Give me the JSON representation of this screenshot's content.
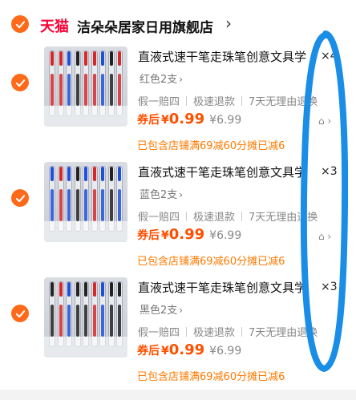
{
  "shop": {
    "platform": "天猫",
    "name": "洁朵朵居家日用旗舰店",
    "chevron": "›"
  },
  "colors": {
    "accent_orange": "#ff6a1a",
    "tmall_red": "#ff0036",
    "price_orange": "#ff5000",
    "promo_orange": "#ff7a00",
    "annotation_blue": "#1a8ee6"
  },
  "items": [
    {
      "title": "直液式速干笔走珠笔创意文具学",
      "quantity": "×4",
      "sku": "红色2支",
      "tags": [
        "假一赔四",
        "极速退款",
        "7天无理由退换"
      ],
      "price_prefix": "券后",
      "currency": "¥",
      "price": "0.99",
      "original_price": "¥6.99",
      "promo": "已包含店铺满69减60分摊已减6",
      "ink_color": "#d62828"
    },
    {
      "title": "直液式速干笔走珠笔创意文具学",
      "quantity": "×3",
      "sku": "蓝色2支",
      "tags": [
        "假一赔四",
        "极速退款",
        "7天无理由退换"
      ],
      "price_prefix": "券后",
      "currency": "¥",
      "price": "0.99",
      "original_price": "¥6.99",
      "promo": "已包含店铺满69减60分摊已减6",
      "ink_color": "#1f4fd6"
    },
    {
      "title": "直液式速干笔走珠笔创意文具学",
      "quantity": "×3",
      "sku": "黑色2支",
      "tags": [
        "假一赔四",
        "极速退款",
        "7天无理由退换"
      ],
      "price_prefix": "券后",
      "currency": "¥",
      "price": "0.99",
      "original_price": "¥6.99",
      "promo": "已包含店铺满69减60分摊已减6",
      "ink_color": "#222222"
    }
  ],
  "icons": {
    "check": "checkmark-icon",
    "service": "service-icon"
  }
}
